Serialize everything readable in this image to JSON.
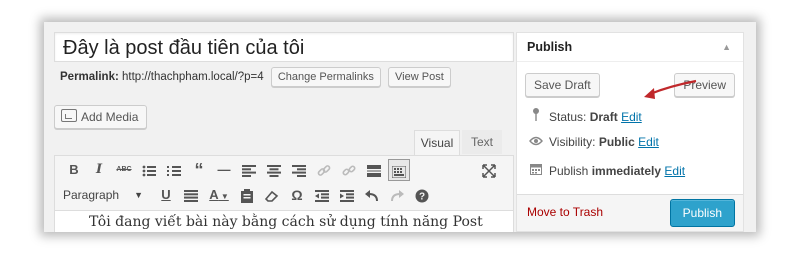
{
  "editor": {
    "title_value": "Đây là post đầu tiên của tôi",
    "permalink_label": "Permalink:",
    "permalink_url": "http://thachpham.local/?p=4",
    "change_permalinks_label": "Change Permalinks",
    "view_post_label": "View Post",
    "add_media_label": "Add Media",
    "tabs": [
      {
        "label": "Visual"
      },
      {
        "label": "Text"
      }
    ],
    "format_select": "Paragraph",
    "content_text": "Tôi đang viết bài này bằng cách sử dụng tính năng Post"
  },
  "publish": {
    "title": "Publish",
    "save_draft_label": "Save Draft",
    "preview_label": "Preview",
    "status_label": "Status:",
    "status_value": "Draft",
    "visibility_label": "Visibility:",
    "visibility_value": "Public",
    "schedule_label": "Publish",
    "schedule_value": "immediately",
    "edit_label": "Edit",
    "trash_label": "Move to Trash",
    "publish_button": "Publish"
  },
  "colors": {
    "publish_blue": "#2ea2cc",
    "link_blue": "#0073aa",
    "trash_red": "#aa0000",
    "annotation_arrow": "#c0282b"
  },
  "icons": {
    "bold": "B",
    "italic": "I",
    "strike": "ABC",
    "bullet_list": "list-icon",
    "numbered_list": "ordered-list-icon",
    "blockquote": "“",
    "hr": "—",
    "align_left": "align-left-icon",
    "align_center": "align-center-icon",
    "align_right": "align-right-icon",
    "link": "link-icon",
    "unlink": "unlink-icon",
    "more": "more-icon",
    "kitchen_sink": "toolbar-toggle-icon",
    "fullscreen": "fullscreen-icon",
    "underline": "U",
    "justify": "justify-icon",
    "text_color": "A",
    "paste_text": "paste-icon",
    "clear_format": "eraser-icon",
    "special_char": "Ω",
    "outdent": "outdent-icon",
    "indent": "indent-icon",
    "undo": "undo-icon",
    "redo": "redo-icon",
    "help": "?"
  }
}
